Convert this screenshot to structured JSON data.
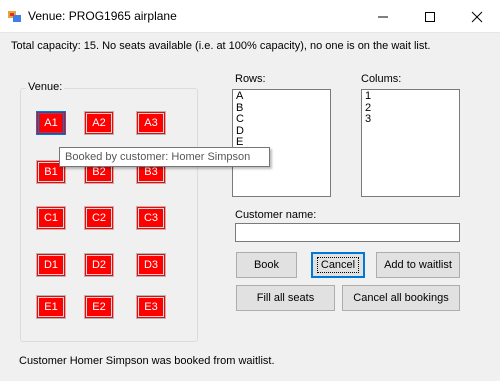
{
  "window": {
    "title": "Venue: PROG1965 airplane",
    "minimize_icon": "minimize-icon",
    "maximize_icon": "maximize-icon",
    "close_icon": "close-icon"
  },
  "capacity_text": "Total capacity: 15. No seats available (i.e. at 100% capacity), no one is on the wait list.",
  "venue": {
    "label": "Venue:",
    "seat_color": "#ff0000",
    "seats": [
      {
        "label": "A1"
      },
      {
        "label": "A2"
      },
      {
        "label": "A3"
      },
      {
        "label": "B1"
      },
      {
        "label": "B2"
      },
      {
        "label": "B3"
      },
      {
        "label": "C1"
      },
      {
        "label": "C2"
      },
      {
        "label": "C3"
      },
      {
        "label": "D1"
      },
      {
        "label": "D2"
      },
      {
        "label": "D3"
      },
      {
        "label": "E1"
      },
      {
        "label": "E2"
      },
      {
        "label": "E3"
      }
    ],
    "tooltip": "Booked by customer: Homer Simpson"
  },
  "rows": {
    "label": "Rows:",
    "items": [
      "A",
      "B",
      "C",
      "D",
      "E"
    ]
  },
  "columns": {
    "label": "Colums:",
    "items": [
      "1",
      "2",
      "3"
    ]
  },
  "customer": {
    "label": "Customer name:",
    "value": ""
  },
  "buttons": {
    "book": "Book",
    "cancel": "Cancel",
    "add_waitlist": "Add to waitlist",
    "fill_all": "Fill all seats",
    "cancel_all": "Cancel all bookings"
  },
  "status_text": "Customer Homer Simpson was booked from waitlist."
}
